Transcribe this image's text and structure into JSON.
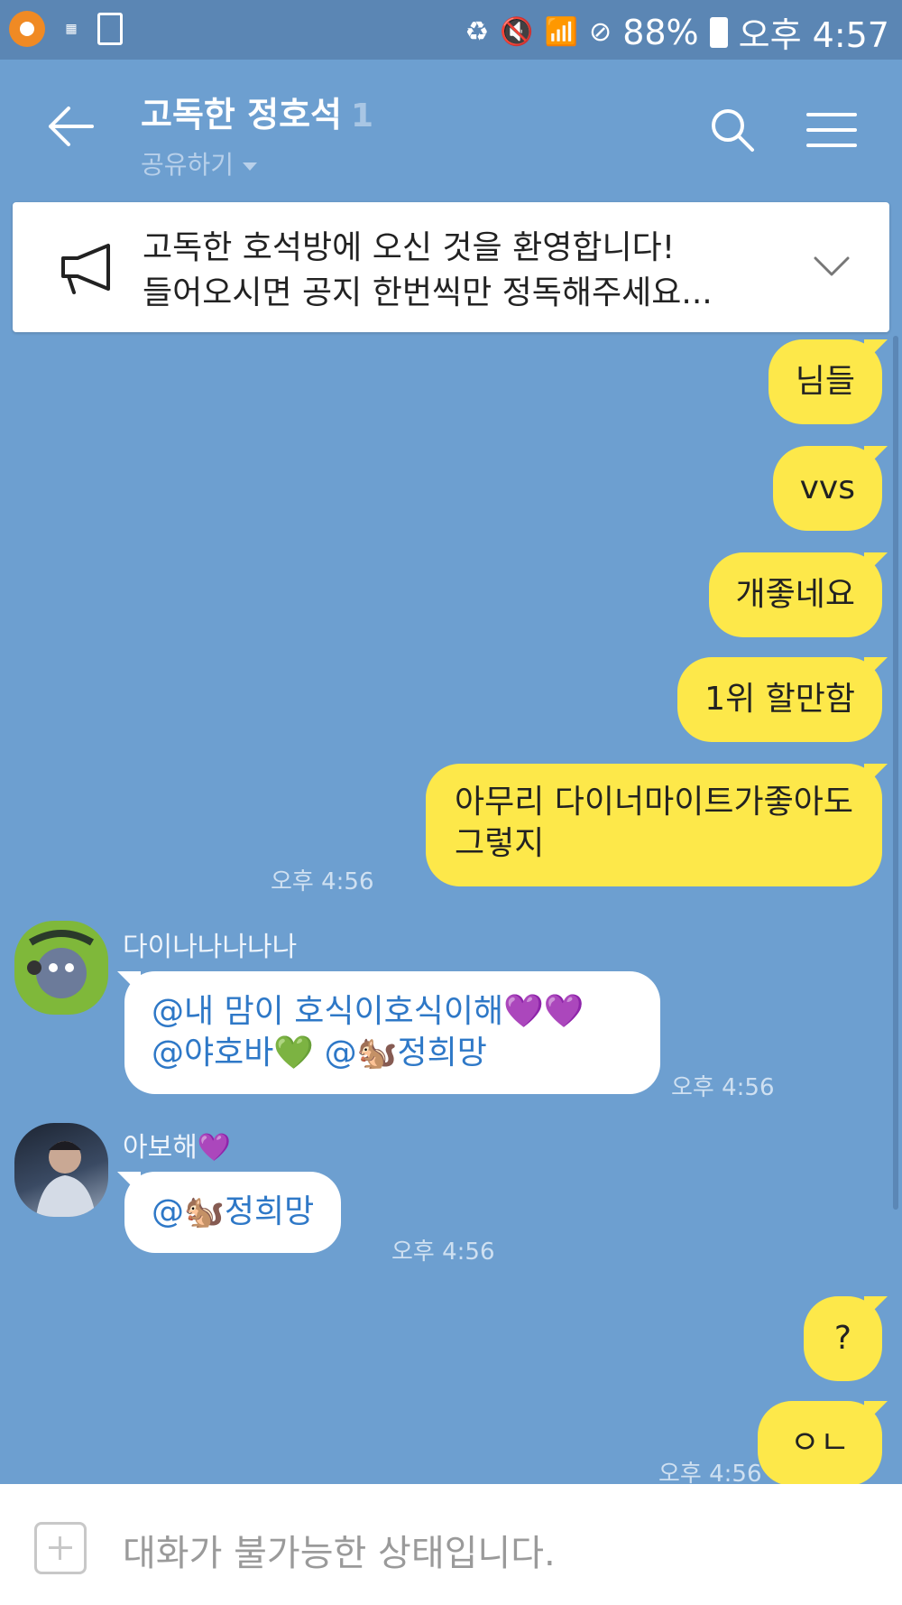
{
  "status_bar": {
    "battery": "88%",
    "time": "오후 4:57"
  },
  "header": {
    "title": "고독한 정호석",
    "member_count": "1",
    "share_label": "공유하기"
  },
  "notice": {
    "line1": "고독한 호석방에 오신 것을 환영합니다!",
    "line2": "들어오시면 공지 한번씩만 정독해주세요..."
  },
  "messages": {
    "m1": "님들",
    "m2": "vvs",
    "m3": "개좋네요",
    "m4": "1위 할만함",
    "m5_line1": "아무리 다이너마이트가좋아도",
    "m5_line2": "그렇지",
    "m5_time": "오후 4:56",
    "u1_name": "다이나나나나나",
    "u1_line1": "@내 맘이 호식이호식이해💜💜",
    "u1_line2": "@야호바💚 @🐿️정희망",
    "u1_time": "오후 4:56",
    "u2_name": "아보해💜",
    "u2_text": "@🐿️정희망",
    "u2_time": "오후 4:56",
    "m6": "?",
    "m7": "ㅇㄴ",
    "m7_time": "오후 4:56"
  },
  "input": {
    "placeholder": "대화가 불가능한 상태입니다."
  }
}
